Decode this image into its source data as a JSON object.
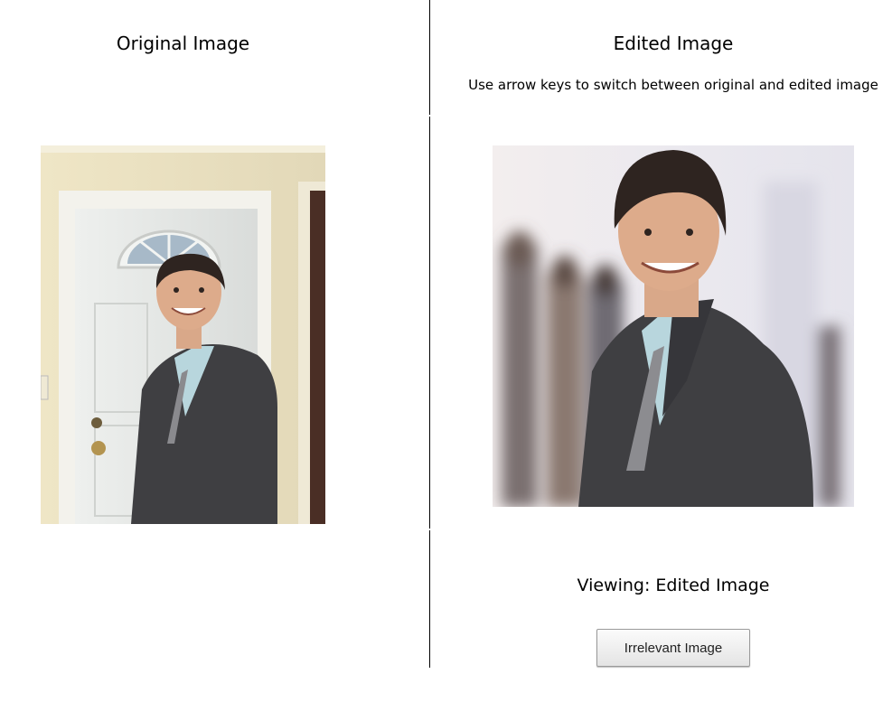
{
  "panels": {
    "original_title": "Original Image",
    "edited_title": "Edited Image",
    "instructions": "Use arrow keys to switch between original and edited image"
  },
  "status": {
    "viewing_text": "Viewing: Edited Image"
  },
  "buttons": {
    "toggle_label": "Irrelevant Image"
  },
  "colors": {
    "wall": "#ece4c8",
    "door": "#e6e8e6",
    "suit": "#3f3f42",
    "shirt": "#b8d6dd",
    "skin": "#d9a889",
    "hair": "#2e2420",
    "blur_bg": "#ece9ee"
  }
}
